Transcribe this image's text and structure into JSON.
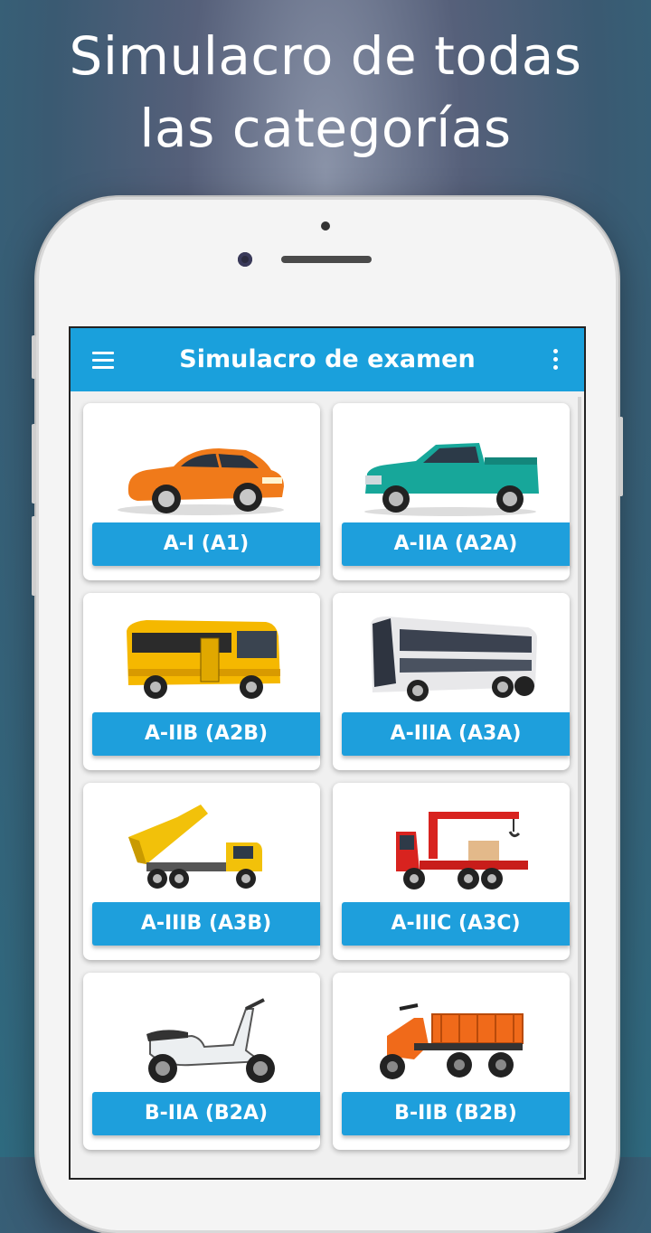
{
  "headline": {
    "line1": "Simulacro de todas",
    "line2": "las categorías"
  },
  "appbar": {
    "title": "Simulacro de examen",
    "left_icon": "hamburger-menu-icon",
    "right_icon": "more-vert-icon",
    "color": "#1aa0dc"
  },
  "categories": [
    {
      "label": "A-I (A1)",
      "icon": "orange-car"
    },
    {
      "label": "A-IIA (A2A)",
      "icon": "green-pickup-truck"
    },
    {
      "label": "A-IIB (A2B)",
      "icon": "yellow-bus"
    },
    {
      "label": "A-IIIA (A3A)",
      "icon": "double-decker-coach"
    },
    {
      "label": "A-IIIB (A3B)",
      "icon": "yellow-dump-truck"
    },
    {
      "label": "A-IIIC (A3C)",
      "icon": "red-crane-truck"
    },
    {
      "label": "B-IIA (B2A)",
      "icon": "scooter"
    },
    {
      "label": "B-IIB (B2B)",
      "icon": "cargo-motor-tricycle"
    }
  ],
  "colors": {
    "label_bg": "#1e9fdc"
  }
}
